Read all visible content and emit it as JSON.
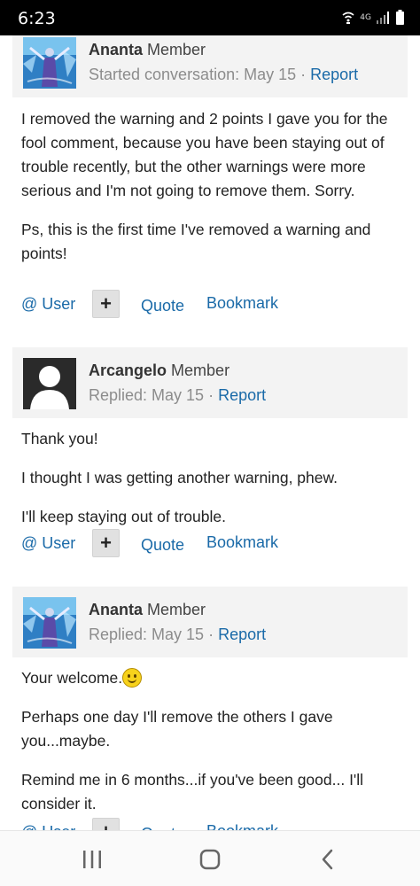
{
  "status_bar": {
    "time": "6:23",
    "network": "4G",
    "icons": [
      "wifi-calling-icon",
      "signal-icon",
      "battery-icon"
    ]
  },
  "posts": [
    {
      "author": "Ananta",
      "role": "Member",
      "meta_prefix": "Started conversation: May 15 · ",
      "report": "Report",
      "avatar": "ananta-avatar-image",
      "paragraphs": [
        "I removed the warning and 2 points I gave you for the fool comment, because you have been staying out of trouble recently, but the other warnings were more serious and I'm not going to remove them. Sorry.",
        "Ps, this is the first time I've removed a warning and points!"
      ]
    },
    {
      "author": "Arcangelo",
      "role": "Member",
      "meta_prefix": "Replied: May 15 · ",
      "report": "Report",
      "avatar": "default-user-avatar",
      "paragraphs": [
        "Thank you!",
        "I thought I was getting another warning, phew.",
        "I'll keep staying out of trouble."
      ]
    },
    {
      "author": "Ananta",
      "role": "Member",
      "meta_prefix": "Replied: May 15 · ",
      "report": "Report",
      "avatar": "ananta-avatar-image",
      "paragraphs": [
        "Your welcome.",
        "Perhaps one day I'll remove the others I gave you...maybe.",
        "Remind me in 6 months...if you've been good... I'll consider it."
      ]
    }
  ],
  "actions": {
    "user": "@ User",
    "plus": "+",
    "quote": "Quote",
    "bookmark": "Bookmark"
  },
  "nav_bar": {
    "icons": [
      "recent-apps-icon",
      "home-icon",
      "back-icon"
    ]
  }
}
